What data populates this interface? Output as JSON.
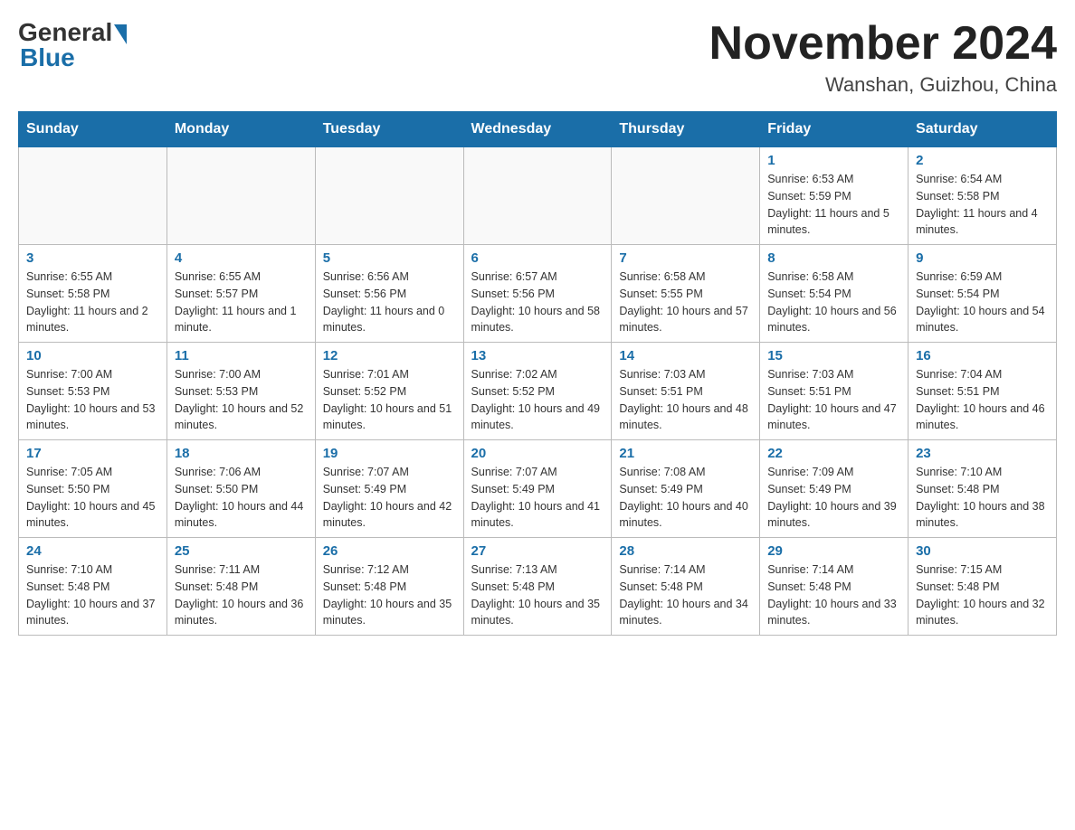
{
  "logo": {
    "general": "General",
    "blue": "Blue"
  },
  "title": "November 2024",
  "location": "Wanshan, Guizhou, China",
  "days_of_week": [
    "Sunday",
    "Monday",
    "Tuesday",
    "Wednesday",
    "Thursday",
    "Friday",
    "Saturday"
  ],
  "weeks": [
    [
      {
        "day": "",
        "info": ""
      },
      {
        "day": "",
        "info": ""
      },
      {
        "day": "",
        "info": ""
      },
      {
        "day": "",
        "info": ""
      },
      {
        "day": "",
        "info": ""
      },
      {
        "day": "1",
        "info": "Sunrise: 6:53 AM\nSunset: 5:59 PM\nDaylight: 11 hours and 5 minutes."
      },
      {
        "day": "2",
        "info": "Sunrise: 6:54 AM\nSunset: 5:58 PM\nDaylight: 11 hours and 4 minutes."
      }
    ],
    [
      {
        "day": "3",
        "info": "Sunrise: 6:55 AM\nSunset: 5:58 PM\nDaylight: 11 hours and 2 minutes."
      },
      {
        "day": "4",
        "info": "Sunrise: 6:55 AM\nSunset: 5:57 PM\nDaylight: 11 hours and 1 minute."
      },
      {
        "day": "5",
        "info": "Sunrise: 6:56 AM\nSunset: 5:56 PM\nDaylight: 11 hours and 0 minutes."
      },
      {
        "day": "6",
        "info": "Sunrise: 6:57 AM\nSunset: 5:56 PM\nDaylight: 10 hours and 58 minutes."
      },
      {
        "day": "7",
        "info": "Sunrise: 6:58 AM\nSunset: 5:55 PM\nDaylight: 10 hours and 57 minutes."
      },
      {
        "day": "8",
        "info": "Sunrise: 6:58 AM\nSunset: 5:54 PM\nDaylight: 10 hours and 56 minutes."
      },
      {
        "day": "9",
        "info": "Sunrise: 6:59 AM\nSunset: 5:54 PM\nDaylight: 10 hours and 54 minutes."
      }
    ],
    [
      {
        "day": "10",
        "info": "Sunrise: 7:00 AM\nSunset: 5:53 PM\nDaylight: 10 hours and 53 minutes."
      },
      {
        "day": "11",
        "info": "Sunrise: 7:00 AM\nSunset: 5:53 PM\nDaylight: 10 hours and 52 minutes."
      },
      {
        "day": "12",
        "info": "Sunrise: 7:01 AM\nSunset: 5:52 PM\nDaylight: 10 hours and 51 minutes."
      },
      {
        "day": "13",
        "info": "Sunrise: 7:02 AM\nSunset: 5:52 PM\nDaylight: 10 hours and 49 minutes."
      },
      {
        "day": "14",
        "info": "Sunrise: 7:03 AM\nSunset: 5:51 PM\nDaylight: 10 hours and 48 minutes."
      },
      {
        "day": "15",
        "info": "Sunrise: 7:03 AM\nSunset: 5:51 PM\nDaylight: 10 hours and 47 minutes."
      },
      {
        "day": "16",
        "info": "Sunrise: 7:04 AM\nSunset: 5:51 PM\nDaylight: 10 hours and 46 minutes."
      }
    ],
    [
      {
        "day": "17",
        "info": "Sunrise: 7:05 AM\nSunset: 5:50 PM\nDaylight: 10 hours and 45 minutes."
      },
      {
        "day": "18",
        "info": "Sunrise: 7:06 AM\nSunset: 5:50 PM\nDaylight: 10 hours and 44 minutes."
      },
      {
        "day": "19",
        "info": "Sunrise: 7:07 AM\nSunset: 5:49 PM\nDaylight: 10 hours and 42 minutes."
      },
      {
        "day": "20",
        "info": "Sunrise: 7:07 AM\nSunset: 5:49 PM\nDaylight: 10 hours and 41 minutes."
      },
      {
        "day": "21",
        "info": "Sunrise: 7:08 AM\nSunset: 5:49 PM\nDaylight: 10 hours and 40 minutes."
      },
      {
        "day": "22",
        "info": "Sunrise: 7:09 AM\nSunset: 5:49 PM\nDaylight: 10 hours and 39 minutes."
      },
      {
        "day": "23",
        "info": "Sunrise: 7:10 AM\nSunset: 5:48 PM\nDaylight: 10 hours and 38 minutes."
      }
    ],
    [
      {
        "day": "24",
        "info": "Sunrise: 7:10 AM\nSunset: 5:48 PM\nDaylight: 10 hours and 37 minutes."
      },
      {
        "day": "25",
        "info": "Sunrise: 7:11 AM\nSunset: 5:48 PM\nDaylight: 10 hours and 36 minutes."
      },
      {
        "day": "26",
        "info": "Sunrise: 7:12 AM\nSunset: 5:48 PM\nDaylight: 10 hours and 35 minutes."
      },
      {
        "day": "27",
        "info": "Sunrise: 7:13 AM\nSunset: 5:48 PM\nDaylight: 10 hours and 35 minutes."
      },
      {
        "day": "28",
        "info": "Sunrise: 7:14 AM\nSunset: 5:48 PM\nDaylight: 10 hours and 34 minutes."
      },
      {
        "day": "29",
        "info": "Sunrise: 7:14 AM\nSunset: 5:48 PM\nDaylight: 10 hours and 33 minutes."
      },
      {
        "day": "30",
        "info": "Sunrise: 7:15 AM\nSunset: 5:48 PM\nDaylight: 10 hours and 32 minutes."
      }
    ]
  ]
}
